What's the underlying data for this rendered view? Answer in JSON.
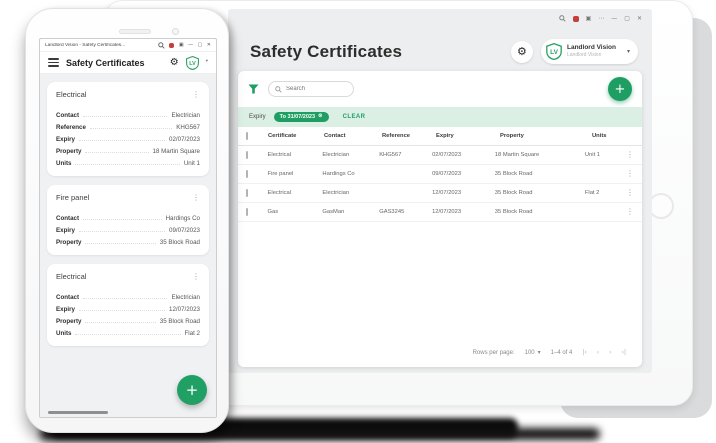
{
  "brand": {
    "logo_text": "LV"
  },
  "colors": {
    "accent_green": "#1f9e63",
    "filter_bar_bg": "#dcefe5",
    "screen_bg": "#eceeef"
  },
  "icons": {
    "gear": "⚙",
    "kebab": "⋮",
    "caret_down": "▾",
    "plus": "+",
    "search": "⌕",
    "squares": "▣",
    "ellipsis": "⋯",
    "minimize": "—",
    "maximize": "▢",
    "close": "✕",
    "clear_circle": "⊗",
    "nav_first": "|‹",
    "nav_prev": "‹",
    "nav_next": "›",
    "nav_last": "›|"
  },
  "phone": {
    "browser": {
      "tab_title": "Landlord Vision - Safety Certificates..."
    },
    "header": {
      "title": "Safety Certificates"
    },
    "cards": [
      {
        "title": "Electrical",
        "fields": [
          {
            "label": "Contact",
            "value": "Electrician"
          },
          {
            "label": "Reference",
            "value": "KHG567"
          },
          {
            "label": "Expiry",
            "value": "02/07/2023"
          },
          {
            "label": "Property",
            "value": "18 Martin Square"
          },
          {
            "label": "Units",
            "value": "Unit 1"
          }
        ]
      },
      {
        "title": "Fire panel",
        "fields": [
          {
            "label": "Contact",
            "value": "Hardings Co"
          },
          {
            "label": "Expiry",
            "value": "09/07/2023"
          },
          {
            "label": "Property",
            "value": "35 Block Road"
          }
        ]
      },
      {
        "title": "Electrical",
        "fields": [
          {
            "label": "Contact",
            "value": "Electrician"
          },
          {
            "label": "Expiry",
            "value": "12/07/2023"
          },
          {
            "label": "Property",
            "value": "35 Block Road"
          },
          {
            "label": "Units",
            "value": "Flat 2"
          }
        ]
      }
    ]
  },
  "tablet": {
    "header": {
      "title": "Safety Certificates",
      "account_name": "Landlord Vision",
      "account_sub": "Landlord Vision"
    },
    "toolbar": {
      "search_placeholder": "Search"
    },
    "filter_bar": {
      "label": "Expiry",
      "chip": "To 31/07/2023",
      "clear_label": "CLEAR"
    },
    "table": {
      "columns": [
        "Certificate",
        "Contact",
        "Reference",
        "Expiry",
        "Property",
        "Units"
      ],
      "rows": [
        {
          "certificate": "Electrical",
          "contact": "Electrician",
          "reference": "KHG567",
          "expiry": "02/07/2023",
          "property": "18 Martin Square",
          "units": "Unit 1"
        },
        {
          "certificate": "Fire panel",
          "contact": "Hardings Co",
          "reference": "",
          "expiry": "09/07/2023",
          "property": "35 Block Road",
          "units": ""
        },
        {
          "certificate": "Electrical",
          "contact": "Electrician",
          "reference": "",
          "expiry": "12/07/2023",
          "property": "35 Block Road",
          "units": "Flat 2"
        },
        {
          "certificate": "Gas",
          "contact": "GasMan",
          "reference": "GAS3245",
          "expiry": "12/07/2023",
          "property": "35 Block Road",
          "units": ""
        }
      ]
    },
    "pagination": {
      "rows_per_page_label": "Rows per page:",
      "rows_per_page_value": "100",
      "range": "1–4 of 4"
    }
  }
}
